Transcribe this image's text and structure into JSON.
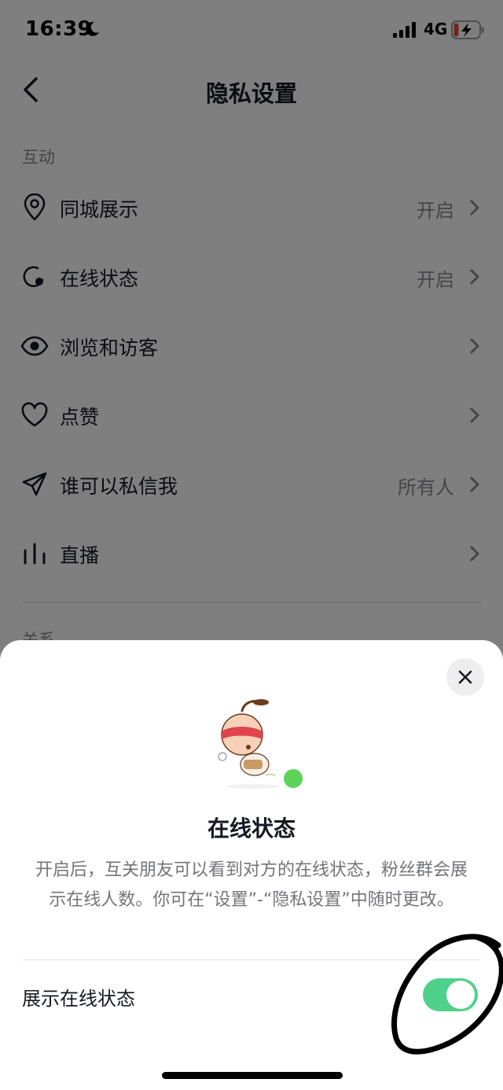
{
  "status_bar": {
    "time": "16:39",
    "network": "4G",
    "icons": [
      "moon-icon",
      "signal-icon",
      "battery-charging-icon"
    ]
  },
  "nav": {
    "title": "隐私设置",
    "back_icon": "chevron-left-icon"
  },
  "sections": {
    "interaction": "互动",
    "relation": "关系"
  },
  "rows": [
    {
      "icon": "location-pin-icon",
      "label": "同城展示",
      "value": "开启"
    },
    {
      "icon": "online-status-icon",
      "label": "在线状态",
      "value": "开启"
    },
    {
      "icon": "eye-icon",
      "label": "浏览和访客",
      "value": ""
    },
    {
      "icon": "heart-icon",
      "label": "点赞",
      "value": ""
    },
    {
      "icon": "paper-plane-icon",
      "label": "谁可以私信我",
      "value": "所有人"
    },
    {
      "icon": "bars-icon",
      "label": "直播",
      "value": ""
    }
  ],
  "sheet": {
    "title": "在线状态",
    "description": "开启后，互关朋友可以看到对方的在线状态，粉丝群会展示在线人数。你可在“设置”-“隐私设置”中随时更改。",
    "toggle_label": "展示在线状态",
    "toggle_on": true,
    "close_icon": "close-icon",
    "avatar": "cartoon-avatar"
  },
  "colors": {
    "toggle_on": "#4fd18b",
    "online_dot": "#5ed35a",
    "text_primary": "#161823",
    "text_secondary": "#8a8b91",
    "battery_charging": "#e8453c"
  }
}
